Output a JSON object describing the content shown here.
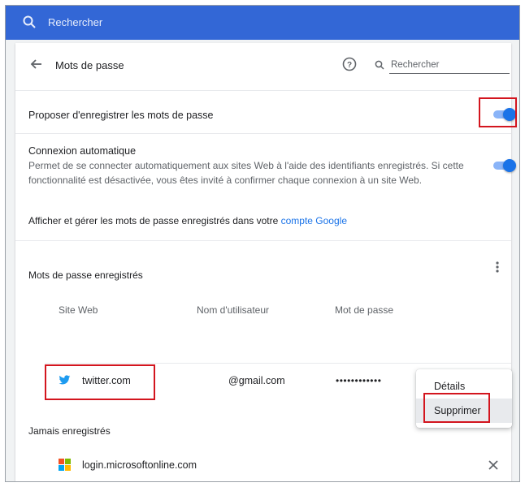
{
  "topbar": {
    "search_placeholder": "Rechercher"
  },
  "header": {
    "title": "Mots de passe",
    "search_placeholder": "Rechercher"
  },
  "settings": {
    "offer_save": {
      "label": "Proposer d'enregistrer les mots de passe",
      "enabled": true
    },
    "auto_signin": {
      "label": "Connexion automatique",
      "description_line1": "Permet de se connecter automatiquement aux sites Web à l'aide des identifiants enregistrés. Si cette",
      "description_line2": "fonctionnalité est désactivée, vous êtes invité à confirmer chaque connexion à un site Web.",
      "enabled": true
    },
    "manage_text": "Afficher et gérer les mots de passe enregistrés dans votre",
    "manage_link": "compte Google"
  },
  "saved": {
    "title": "Mots de passe enregistrés",
    "columns": {
      "site": "Site Web",
      "user": "Nom d'utilisateur",
      "password": "Mot de passe"
    },
    "rows": [
      {
        "site": "twitter.com",
        "user": "@gmail.com",
        "password": "••••••••••••",
        "icon": "twitter-bird-icon"
      }
    ]
  },
  "context_menu": {
    "details": "Détails",
    "remove": "Supprimer"
  },
  "never_saved": {
    "title": "Jamais enregistrés",
    "rows": [
      {
        "site": "login.microsoftonline.com",
        "icon": "microsoft-logo-icon"
      }
    ]
  },
  "colors": {
    "accent": "#1a73e8",
    "topbar": "#3367d6",
    "highlight": "#d3151e"
  }
}
